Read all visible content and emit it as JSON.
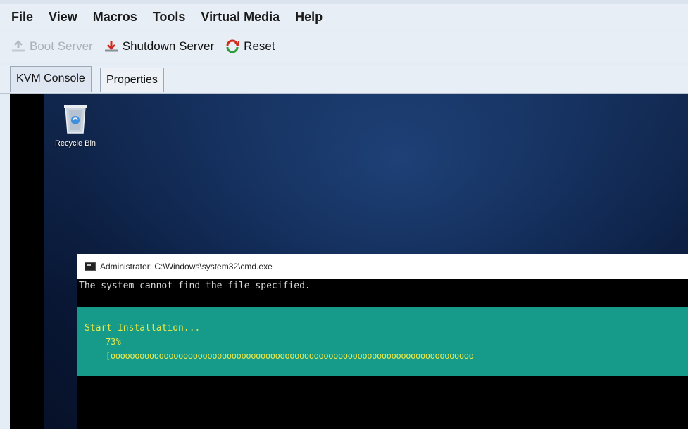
{
  "menu": {
    "items": [
      "File",
      "View",
      "Macros",
      "Tools",
      "Virtual Media",
      "Help"
    ]
  },
  "toolbar": {
    "boot_label": "Boot Server",
    "shutdown_label": "Shutdown Server",
    "reset_label": "Reset",
    "colors": {
      "disabled": "#a9b0b8",
      "shutdown_arrow": "#d12a1c",
      "reset_red": "#d12a1c",
      "reset_green": "#2e9b3a"
    }
  },
  "tabs": {
    "active": "KVM Console",
    "inactive": "Properties"
  },
  "desktop": {
    "recycle_bin_label": "Recycle Bin",
    "icon": "recycle-bin-icon"
  },
  "cmd": {
    "title": "Administrator: C:\\Windows\\system32\\cmd.exe",
    "line1": "The system cannot find the file specified.",
    "install_title": "Start Installation...",
    "progress_text": "73%",
    "progress_value": 73,
    "progress_bar": "[ooooooooooooooooooooooooooooooooooooooooooooooooooooooooooooooooooooooooooo",
    "colors": {
      "install_bg": "#169a8a",
      "install_text": "#e6e94a"
    }
  }
}
